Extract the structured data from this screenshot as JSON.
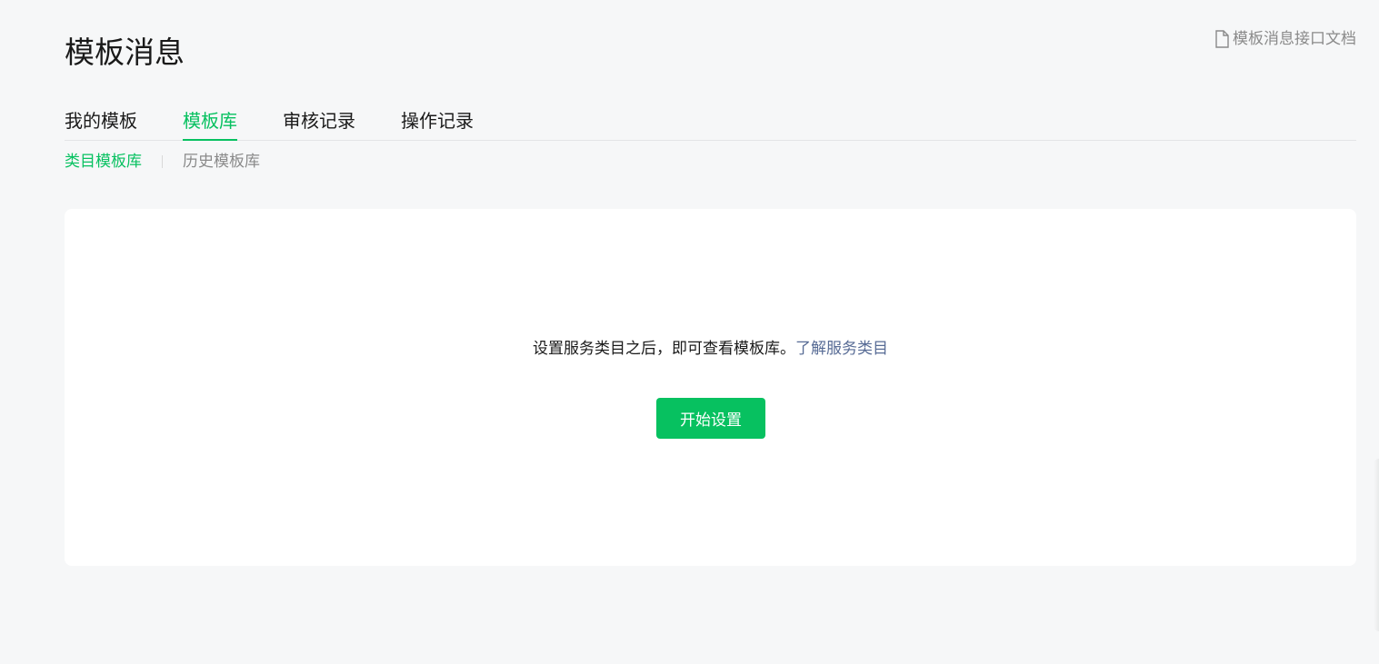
{
  "page": {
    "title": "模板消息"
  },
  "doc_link": {
    "icon": "document-icon",
    "label": "模板消息接口文档"
  },
  "tabs": [
    {
      "label": "我的模板",
      "active": false
    },
    {
      "label": "模板库",
      "active": true
    },
    {
      "label": "审核记录",
      "active": false
    },
    {
      "label": "操作记录",
      "active": false
    }
  ],
  "subtabs": [
    {
      "label": "类目模板库",
      "active": true
    },
    {
      "label": "历史模板库",
      "active": false
    }
  ],
  "empty_state": {
    "message": "设置服务类目之后，即可查看模板库。",
    "link_label": "了解服务类目",
    "button_label": "开始设置"
  },
  "colors": {
    "accent": "#07c160",
    "link": "#576b95",
    "background": "#f6f7f8",
    "card": "#ffffff",
    "muted_text": "#8a8a8a"
  }
}
